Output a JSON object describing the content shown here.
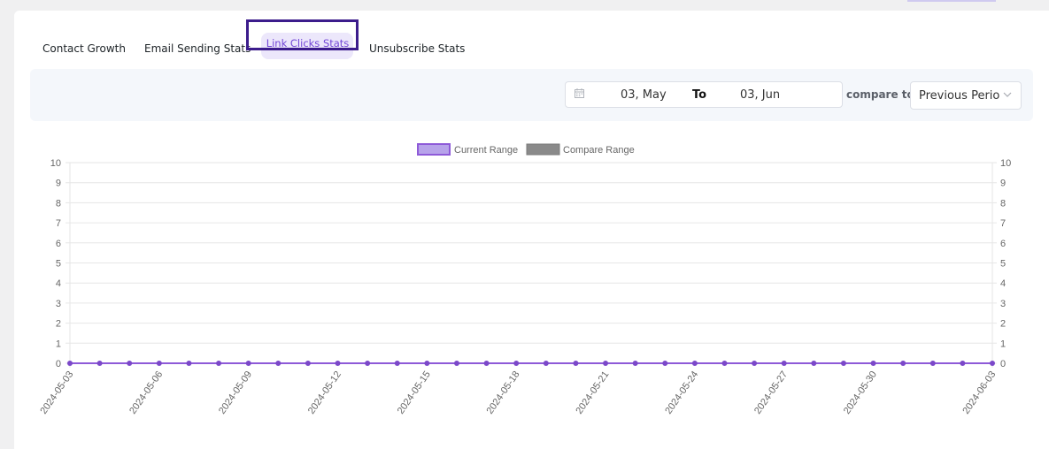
{
  "tabs": [
    {
      "label": "Contact Growth",
      "active": false
    },
    {
      "label": "Email Sending Stats",
      "active": false
    },
    {
      "label": "Link Clicks Stats",
      "active": true
    },
    {
      "label": "Unsubscribe Stats",
      "active": false
    }
  ],
  "filter": {
    "start_date": "03, May",
    "separator": "To",
    "end_date": "03, Jun",
    "compare_label": "compare to",
    "compare_value": "Previous Perio"
  },
  "colors": {
    "accent": "#7246d6",
    "current_fill": "#b7a3ea",
    "current_line": "#8e5ad8",
    "compare_fill": "#8a8a8a"
  },
  "chart_data": {
    "type": "line",
    "legend": [
      "Current Range",
      "Compare Range"
    ],
    "legend_position": "top-center",
    "ylim": [
      0,
      10
    ],
    "yticks": [
      0,
      1,
      2,
      3,
      4,
      5,
      6,
      7,
      8,
      9,
      10
    ],
    "y_axis_both_sides": true,
    "grid": true,
    "x": [
      "2024-05-03",
      "2024-05-04",
      "2024-05-05",
      "2024-05-06",
      "2024-05-07",
      "2024-05-08",
      "2024-05-09",
      "2024-05-10",
      "2024-05-11",
      "2024-05-12",
      "2024-05-13",
      "2024-05-14",
      "2024-05-15",
      "2024-05-16",
      "2024-05-17",
      "2024-05-18",
      "2024-05-19",
      "2024-05-20",
      "2024-05-21",
      "2024-05-22",
      "2024-05-23",
      "2024-05-24",
      "2024-05-25",
      "2024-05-26",
      "2024-05-27",
      "2024-05-28",
      "2024-05-29",
      "2024-05-30",
      "2024-05-31",
      "2024-06-01",
      "2024-06-02",
      "2024-06-03"
    ],
    "xtick_labels": [
      "2024-05-03",
      "2024-05-06",
      "2024-05-09",
      "2024-05-12",
      "2024-05-15",
      "2024-05-18",
      "2024-05-21",
      "2024-05-24",
      "2024-05-27",
      "2024-05-30",
      "2024-06-03"
    ],
    "series": [
      {
        "name": "Current Range",
        "values": [
          0,
          0,
          0,
          0,
          0,
          0,
          0,
          0,
          0,
          0,
          0,
          0,
          0,
          0,
          0,
          0,
          0,
          0,
          0,
          0,
          0,
          0,
          0,
          0,
          0,
          0,
          0,
          0,
          0,
          0,
          0,
          0
        ]
      }
    ]
  }
}
